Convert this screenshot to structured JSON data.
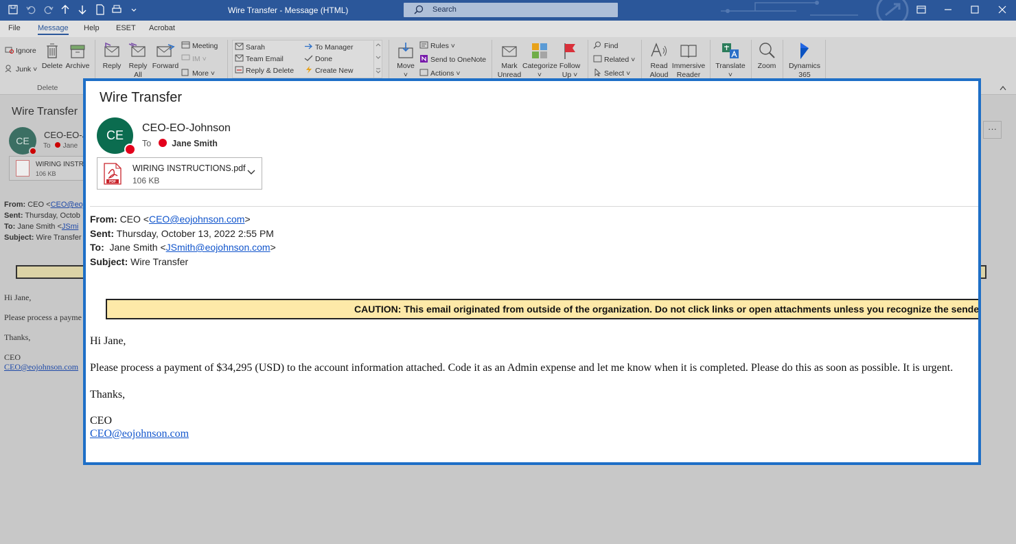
{
  "titlebar": {
    "title": "Wire Transfer  -  Message (HTML)",
    "search_placeholder": "Search",
    "icons": [
      "save-icon",
      "undo-icon",
      "redo-icon",
      "up-arrow-icon",
      "down-arrow-icon",
      "print-preview-icon",
      "print-icon",
      "customize-icon"
    ]
  },
  "tabs": [
    "File",
    "Message",
    "Help",
    "ESET",
    "Acrobat"
  ],
  "active_tab": "Message",
  "ribbon": {
    "delete_group": {
      "ignore": "Ignore",
      "junk": "Junk",
      "delete": "Delete",
      "archive": "Archive",
      "label": "Delete"
    },
    "respond": {
      "reply": "Reply",
      "reply_all_1": "Reply",
      "reply_all_2": "All",
      "forward": "Forward",
      "meeting": "Meeting",
      "im": "IM",
      "more": "More"
    },
    "quicksteps": {
      "sarah": "Sarah",
      "team_email": "Team Email",
      "reply_delete": "Reply & Delete",
      "to_manager": "To Manager",
      "done": "Done",
      "create_new": "Create New"
    },
    "move": {
      "move": "Move",
      "rules": "Rules",
      "onenote": "Send to OneNote",
      "actions": "Actions"
    },
    "tags": {
      "mark_unread_1": "Mark",
      "mark_unread_2": "Unread",
      "categorize": "Categorize",
      "follow_up_1": "Follow",
      "follow_up_2": "Up"
    },
    "editing": {
      "find": "Find",
      "related": "Related",
      "select": "Select"
    },
    "speech": {
      "read_aloud_1": "Read",
      "read_aloud_2": "Aloud",
      "immersive_1": "Immersive",
      "immersive_2": "Reader"
    },
    "translate": "Translate",
    "zoom": "Zoom",
    "dynamics_1": "Dynamics",
    "dynamics_2": "365"
  },
  "background": {
    "subject": "Wire Transfer",
    "avatar": "CE",
    "sender": "CEO-EO-Jo",
    "to_label": "To",
    "to_name": "Jane",
    "attach_name": "WIRING INSTRU",
    "attach_size": "106 KB",
    "from_label": "From:",
    "from_text": "CEO <",
    "from_email": "CEO@eoj",
    "sent_label": "Sent:",
    "sent_text": "Thursday, Octob",
    "to_hdr_label": "To:",
    "to_hdr_text": "Jane Smith  <",
    "to_hdr_email": "JSmi",
    "subject_label": "Subject:",
    "subject_text": "Wire Transfer",
    "greeting": "Hi Jane,",
    "body": "Please process a payme",
    "thanks": "Thanks,",
    "sig": "CEO",
    "sig_email": "CEO@eojohnson.com",
    "more_button": "···"
  },
  "email": {
    "subject": "Wire Transfer",
    "avatar_initials": "CE",
    "sender": "CEO-EO-Johnson",
    "to_label": "To",
    "recipient": "Jane Smith",
    "attachment": {
      "name": "WIRING INSTRUCTIONS.pdf",
      "size": "106 KB"
    },
    "header": {
      "from_label": "From:",
      "from_name": "CEO <",
      "from_email": "CEO@eojohnson.com",
      "from_close": ">",
      "sent_label": "Sent:",
      "sent_value": "Thursday, October 13, 2022 2:55 PM",
      "to_label": "To:",
      "to_name": "Jane Smith  <",
      "to_email": "JSmith@eojohnson.com",
      "to_close": ">",
      "subject_label": "Subject:",
      "subject_value": "Wire Transfer"
    },
    "caution": "CAUTION: This email originated from outside of the organization. Do not click links or open attachments unless you recognize the sende",
    "body": {
      "greeting": "Hi Jane,",
      "message": "Please process a payment of $34,295 (USD) to the account information attached. Code it as an Admin expense and let me know when it is completed. Please do this as soon as possible. It is urgent.",
      "closing": "Thanks,",
      "signature": "CEO",
      "signature_email": "CEO@eojohnson.com"
    }
  },
  "colors": {
    "titlebar": "#2b579a",
    "popout_border": "#1e6fc7",
    "avatar": "#0b6c4f",
    "presence_busy": "#e3001b",
    "caution_bg": "#fde9a8",
    "link": "#1155cc"
  }
}
